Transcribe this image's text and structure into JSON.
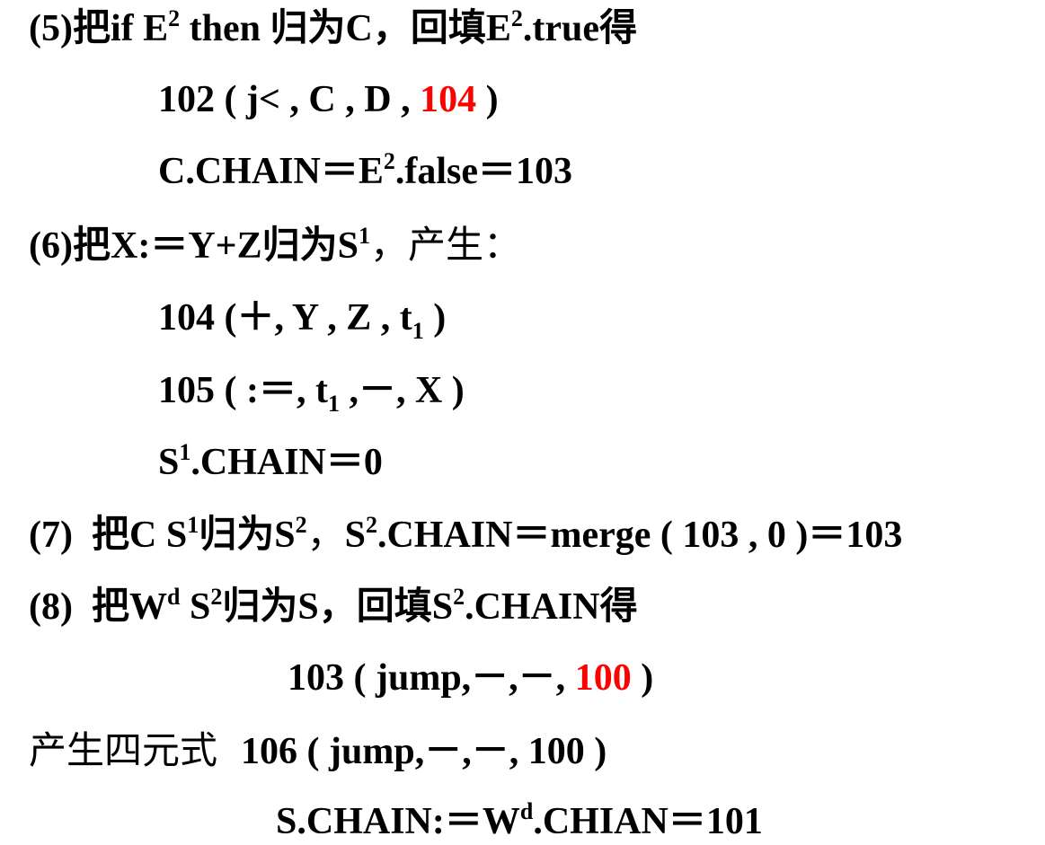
{
  "colors": {
    "text": "#000000",
    "highlight": "#ff0000"
  },
  "lines": {
    "l5": {
      "a": "(5)",
      "b": "把",
      "c": "if E",
      "d": "2",
      "e": " then ",
      "f": "归为",
      "g": "C，",
      "h": "回填",
      "i": "E",
      "j": "2",
      "k": ".true",
      "l": "得"
    },
    "l5_q": {
      "a": "102 ( j< , C , D , ",
      "b": "104",
      "c": " )"
    },
    "l5_chain": {
      "a": "C.CHAIN＝E",
      "b": "2",
      "c": ".false＝103"
    },
    "l6": {
      "a": "(6)",
      "b": "把",
      "c": "X:＝Y+Z",
      "d": "归为",
      "e": "S",
      "f": "1",
      "g": "，产生：",
      "h": ""
    },
    "l6_q1": {
      "a": "104 (＋, Y , Z , t",
      "b": "1",
      "c": " )"
    },
    "l6_q2": {
      "a": "105 ( :＝, t",
      "b": "1",
      "c": " ,－, X )"
    },
    "l6_chain": {
      "a": "S",
      "b": "1",
      "c": ".CHAIN＝0"
    },
    "l7": {
      "a": "(7)  ",
      "b": "把",
      "c": "C S",
      "d": "1",
      "e": "归为",
      "f": "S",
      "g": "2",
      "h": "，",
      "i": "S",
      "j": "2",
      "k": ".CHAIN＝merge ( 103 , 0 )＝103"
    },
    "l8": {
      "a": "(8)  ",
      "b": "把",
      "c": "W",
      "d": "d",
      "e": " S",
      "f": "2",
      "g": "归为",
      "h": "S，",
      "i": "回填",
      "j": "S",
      "k": "2",
      "l": ".CHAIN",
      "m": "得"
    },
    "l8_q": {
      "a": "103 ( jump,－,－, ",
      "b": "100",
      "c": " )"
    },
    "l9": {
      "a": "产生四元式",
      "b": "106 ( jump,－,－, 100 )"
    },
    "l9_chain": {
      "a": "S.CHAIN:＝W",
      "b": "d",
      "c": ".CHIAN＝101"
    }
  }
}
